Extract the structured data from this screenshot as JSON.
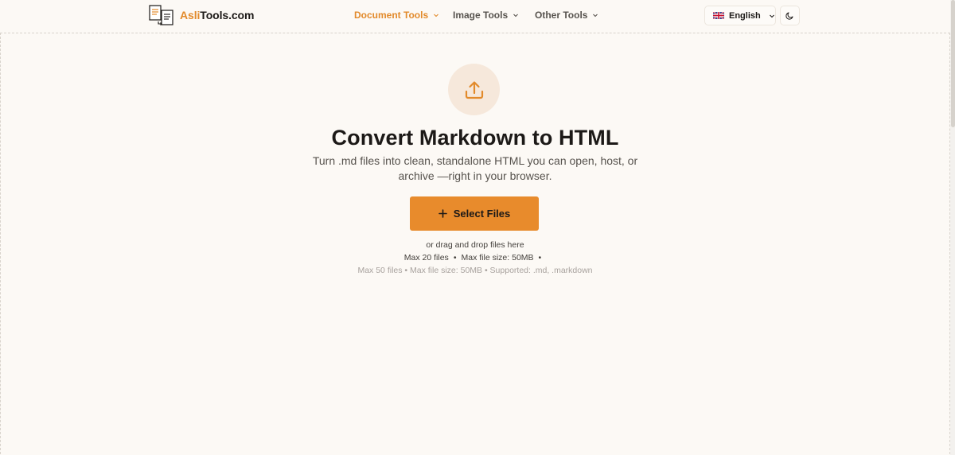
{
  "header": {
    "logo_accent": "Asli",
    "logo_rest": "Tools.com",
    "nav": [
      {
        "label": "Document Tools",
        "active": true
      },
      {
        "label": "Image Tools",
        "active": false
      },
      {
        "label": "Other Tools",
        "active": false
      }
    ],
    "language": "English",
    "icons": {
      "logo": "document-convert-icon",
      "flag": "uk-flag-icon",
      "theme": "moon-icon",
      "dropdown": "chevron-down-icon"
    }
  },
  "main": {
    "icon": "upload-icon",
    "title": "Convert Markdown to HTML",
    "subtitle": "Turn .md files into clean, standalone HTML you can open, host, or archive —right in your browser.",
    "select_button": "Select Files",
    "drag_hint": "or drag and drop files here",
    "limits_line1_a": "Max 20 files",
    "limits_line1_b": "Max file size: 50MB",
    "limits_line2": "Max 50 files • Max file size: 50MB • Supported: .md, .markdown",
    "separator": "•"
  },
  "colors": {
    "accent": "#e88b2c",
    "accent_text": "#e28a2b",
    "background": "#fcf9f5",
    "icon_circle": "#f6e8db"
  }
}
